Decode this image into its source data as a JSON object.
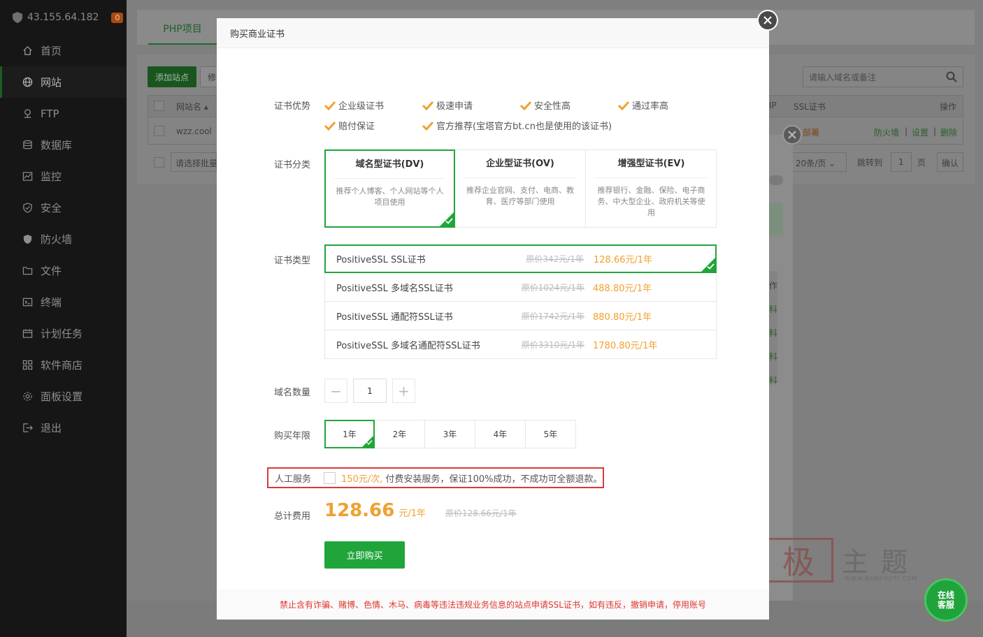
{
  "sidebar": {
    "server_ip": "43.155.64.182",
    "badge": "0",
    "items": [
      {
        "label": "首页",
        "icon": "home-icon"
      },
      {
        "label": "网站",
        "icon": "globe-icon",
        "active": true
      },
      {
        "label": "FTP",
        "icon": "ftp-icon"
      },
      {
        "label": "数据库",
        "icon": "database-icon"
      },
      {
        "label": "监控",
        "icon": "monitor-icon"
      },
      {
        "label": "安全",
        "icon": "shield-check-icon"
      },
      {
        "label": "防火墙",
        "icon": "firewall-icon"
      },
      {
        "label": "文件",
        "icon": "folder-icon"
      },
      {
        "label": "终端",
        "icon": "terminal-icon"
      },
      {
        "label": "计划任务",
        "icon": "calendar-icon"
      },
      {
        "label": "软件商店",
        "icon": "grid-icon"
      },
      {
        "label": "面板设置",
        "icon": "gear-icon"
      },
      {
        "label": "退出",
        "icon": "logout-icon"
      }
    ]
  },
  "background": {
    "tab": "PHP项目",
    "add_site": "添加站点",
    "modify": "修",
    "search_placeholder": "请输入域名或备注",
    "col_sitename": "网站名",
    "col_ip": "IP",
    "col_ssl": "SSL证书",
    "col_ops": "操作",
    "row_site": "wzz.cool",
    "row_status": "部署",
    "op_firewall": "防火墙",
    "op_settings": "设置",
    "op_delete": "删除",
    "batch_placeholder": "请选择批量",
    "per_page": "20条/页",
    "jump_to": "跳转到",
    "page_num": "1",
    "page_unit": "页",
    "confirm": "确认",
    "side_col": "作",
    "side_cells": [
      "科",
      "科",
      "科",
      "科"
    ]
  },
  "modal": {
    "title": "购买商业证书",
    "labels": {
      "advantages": "证书优势",
      "category": "证书分类",
      "type": "证书类型",
      "domain_count": "域名数量",
      "years": "购买年限",
      "service": "人工服务",
      "total": "总计费用"
    },
    "advantages": [
      "企业级证书",
      "极速申请",
      "安全性高",
      "通过率高",
      "赔付保证",
      "官方推荐(宝塔官方bt.cn也是使用的该证书)"
    ],
    "categories": [
      {
        "name": "域名型证书(DV)",
        "desc": "推荐个人博客、个人网站等个人项目使用",
        "selected": true
      },
      {
        "name": "企业型证书(OV)",
        "desc": "推荐企业官网、支付、电商、教育、医疗等部门使用",
        "selected": false
      },
      {
        "name": "增强型证书(EV)",
        "desc": "推荐银行、金融、保险、电子商务、中大型企业、政府机关等使用",
        "selected": false
      }
    ],
    "types": [
      {
        "name": "PositiveSSL SSL证书",
        "orig": "原价342元/1年",
        "price": "128.66元/1年",
        "selected": true
      },
      {
        "name": "PositiveSSL 多域名SSL证书",
        "orig": "原价1024元/1年",
        "price": "488.80元/1年",
        "selected": false
      },
      {
        "name": "PositiveSSL 通配符SSL证书",
        "orig": "原价1742元/1年",
        "price": "880.80元/1年",
        "selected": false
      },
      {
        "name": "PositiveSSL 多域名通配符SSL证书",
        "orig": "原价3310元/1年",
        "price": "1780.80元/1年",
        "selected": false
      }
    ],
    "domain_count": "1",
    "years": [
      {
        "label": "1年",
        "selected": true
      },
      {
        "label": "2年",
        "selected": false
      },
      {
        "label": "3年",
        "selected": false
      },
      {
        "label": "4年",
        "selected": false
      },
      {
        "label": "5年",
        "selected": false
      }
    ],
    "service_fee": "150元/次,",
    "service_note": "付费安装服务，保证100%成功，不成功可全额退款。",
    "total_value": "128.66",
    "total_unit": "元/1年",
    "total_orig": "原价128.66元/1年",
    "buy_button": "立即购买",
    "footer_warning": "禁止含有诈骗、赌博、色情、木马、病毒等违法违规业务信息的站点申请SSL证书，如有违反，撤销申请，停用账号"
  },
  "watermark": {
    "seal": "极",
    "text": "主题",
    "url": "WWW.BANZHUTI.COM"
  },
  "online_service": {
    "line1": "在线",
    "line2": "客服"
  },
  "colors": {
    "accent": "#20a53a",
    "price": "#f0a030",
    "warning": "#e0362e",
    "highlight_box": "#d63b3b"
  }
}
